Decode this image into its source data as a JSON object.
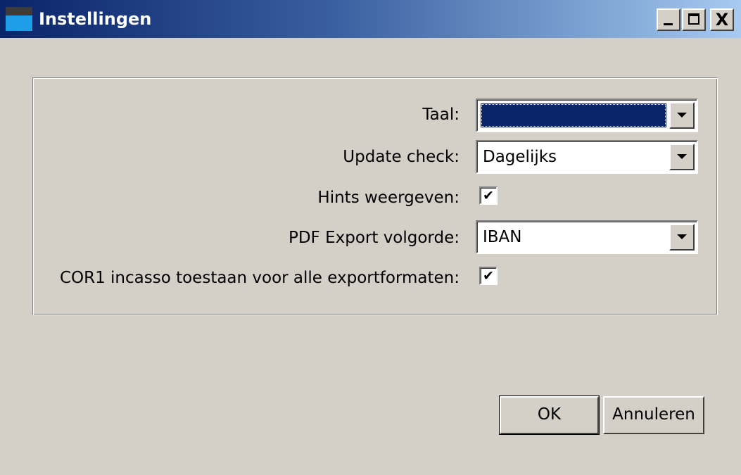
{
  "window": {
    "title": "Instellingen",
    "controls": {
      "minimize": "_",
      "maximize": "□",
      "close": "X"
    }
  },
  "settings": {
    "language": {
      "label": "Taal:",
      "value": ""
    },
    "update_check": {
      "label": "Update check:",
      "value": "Dagelijks"
    },
    "hints": {
      "label": "Hints weergeven:",
      "checked": true,
      "mark": "✔"
    },
    "pdf_export_order": {
      "label": "PDF Export volgorde:",
      "value": "IBAN"
    },
    "cor1_incasso": {
      "label": "COR1 incasso toestaan voor alle exportformaten:",
      "checked": true,
      "mark": "✔"
    }
  },
  "buttons": {
    "ok": "OK",
    "cancel": "Annuleren"
  },
  "colors": {
    "face": "#d4d0c8",
    "titlebar_start": "#0a246a",
    "titlebar_end": "#a6caf0",
    "selection": "#0a246a"
  }
}
